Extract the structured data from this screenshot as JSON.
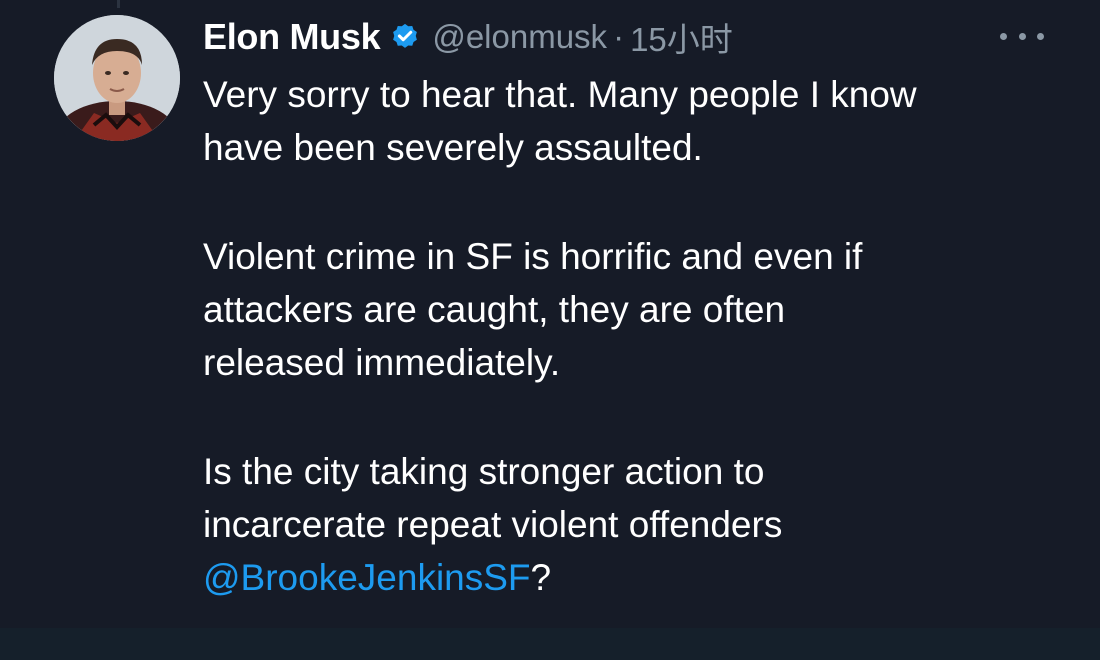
{
  "tweet": {
    "author": {
      "name": "Elon Musk",
      "handle": "@elonmusk",
      "verified": true
    },
    "separator": "·",
    "timestamp": "15小时",
    "paragraphs": [
      [
        "Very sorry to hear that. Many people I know",
        "have been severely assaulted."
      ],
      [
        "Violent crime in SF is horrific and even if",
        "attackers are caught, they are often",
        "released immediately."
      ],
      [
        "Is the city taking stronger action to",
        "incarcerate repeat violent offenders"
      ]
    ],
    "mention": "@BrookeJenkinsSF",
    "mention_suffix": "?"
  },
  "icons": {
    "verified": "verified-badge-icon",
    "more": "more-options-icon"
  },
  "colors": {
    "background": "#161b27",
    "text": "#ffffff",
    "secondary_text": "#8b98a5",
    "link": "#1d9bf0",
    "verified_badge": "#1d9bf0"
  }
}
